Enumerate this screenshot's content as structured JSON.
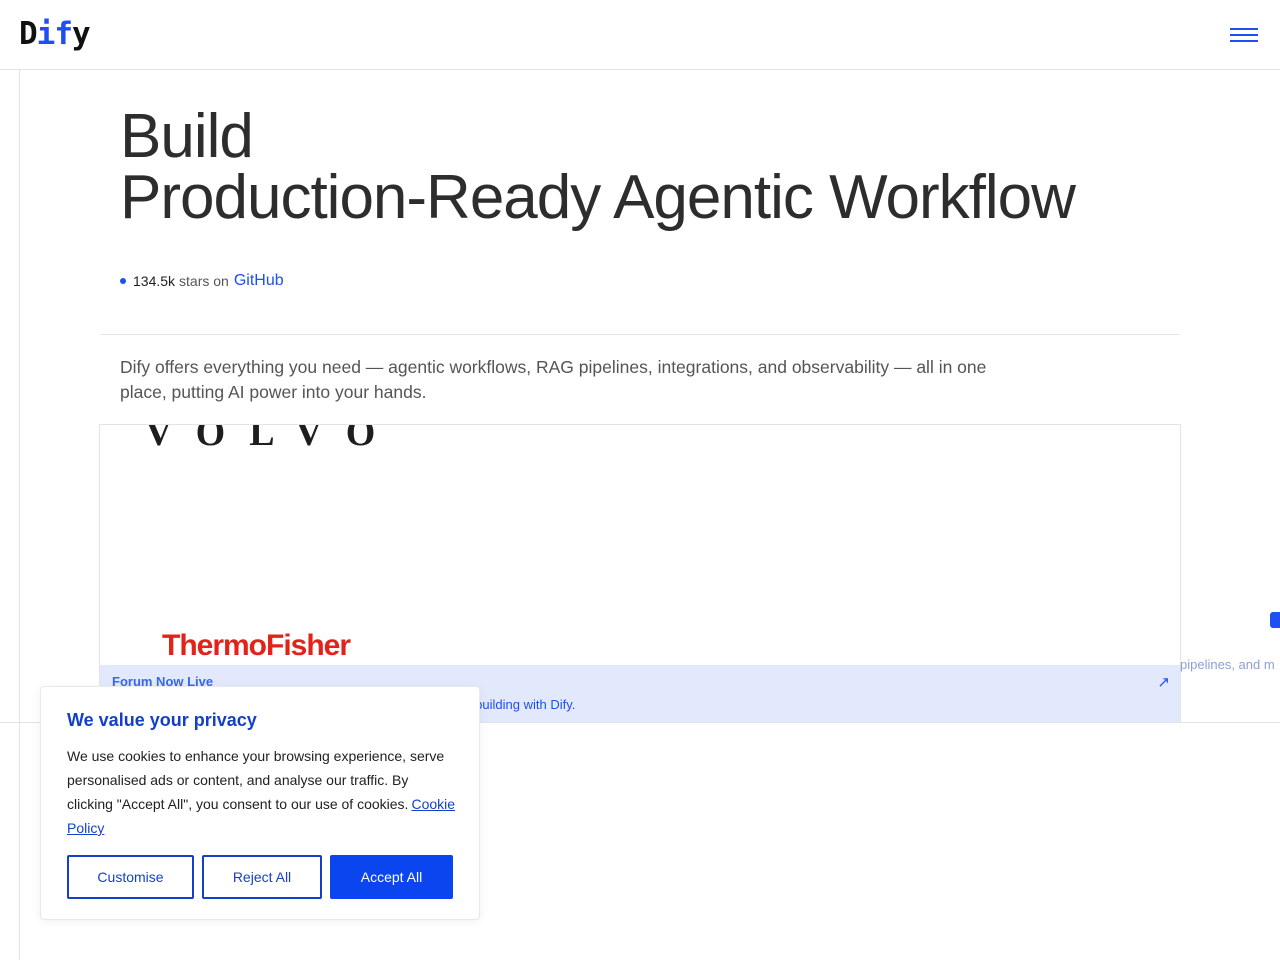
{
  "header": {
    "logo": {
      "part1": "D",
      "part2": "if",
      "part3": "y"
    },
    "menu_icon": "hamburger-menu-icon"
  },
  "hero": {
    "title_line1": "Build",
    "title_line2": "Production-Ready Agentic Workflow",
    "stars_count": "134.5k",
    "stars_text": "stars on",
    "github_link": "GitHub",
    "description": "Dify offers everything you need — agentic workflows, RAG pipelines, integrations, and observability — all in one place, putting AI power into your hands."
  },
  "customers": {
    "logos": [
      "VOLVO",
      "ThermoFisher"
    ]
  },
  "forum_banner": {
    "title": "Forum Now Live",
    "subtitle": "re building with Dify.",
    "arrow_icon": "external-arrow-icon"
  },
  "overflow": {
    "text": "pipelines, and m"
  },
  "cookie": {
    "title": "We value your privacy",
    "body": "We use cookies to enhance your browsing experience, serve personalised ads or content, and analyse our traffic. By clicking \"Accept All\", you consent to our use of cookies.",
    "policy_link": "Cookie Policy",
    "customise_label": "Customise",
    "reject_label": "Reject All",
    "accept_label": "Accept All"
  },
  "colors": {
    "accent": "#1d4ff2",
    "banner_bg": "#e3e9fd",
    "thermo_red": "#e2231a"
  }
}
